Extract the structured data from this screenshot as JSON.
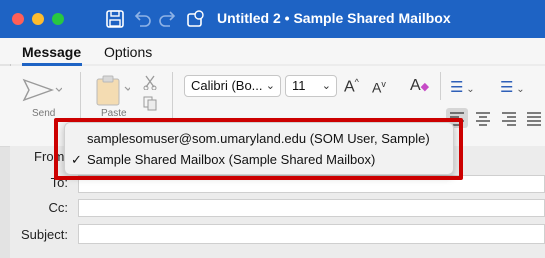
{
  "window": {
    "title": "Untitled 2 • Sample Shared Mailbox"
  },
  "tabs": [
    {
      "label": "Message"
    },
    {
      "label": "Options"
    }
  ],
  "ribbon": {
    "send_label": "Send",
    "paste_label": "Paste",
    "font_name": "Calibri (Bo...",
    "font_size": "11"
  },
  "compose": {
    "from_label": "From:",
    "to_label": "To:",
    "cc_label": "Cc:",
    "subject_label": "Subject:"
  },
  "from_menu": {
    "items": [
      {
        "label": "samplesomuser@som.umaryland.edu (SOM User, Sample)",
        "checked": false
      },
      {
        "label": "Sample Shared Mailbox (Sample Shared Mailbox)",
        "checked": true
      }
    ],
    "check_glyph": "✓"
  },
  "colors": {
    "titlebar": "#1e63c4",
    "highlight": "#cc0000"
  },
  "icons": [
    "save-icon",
    "undo-icon",
    "redo-icon",
    "sync-icon",
    "send-icon",
    "paste-icon",
    "cut-icon",
    "copy-icon",
    "grow-font-icon",
    "shrink-font-icon",
    "clear-formatting-icon",
    "bullets-icon",
    "numbering-icon",
    "align-left-icon",
    "align-center-icon",
    "align-right-icon"
  ]
}
